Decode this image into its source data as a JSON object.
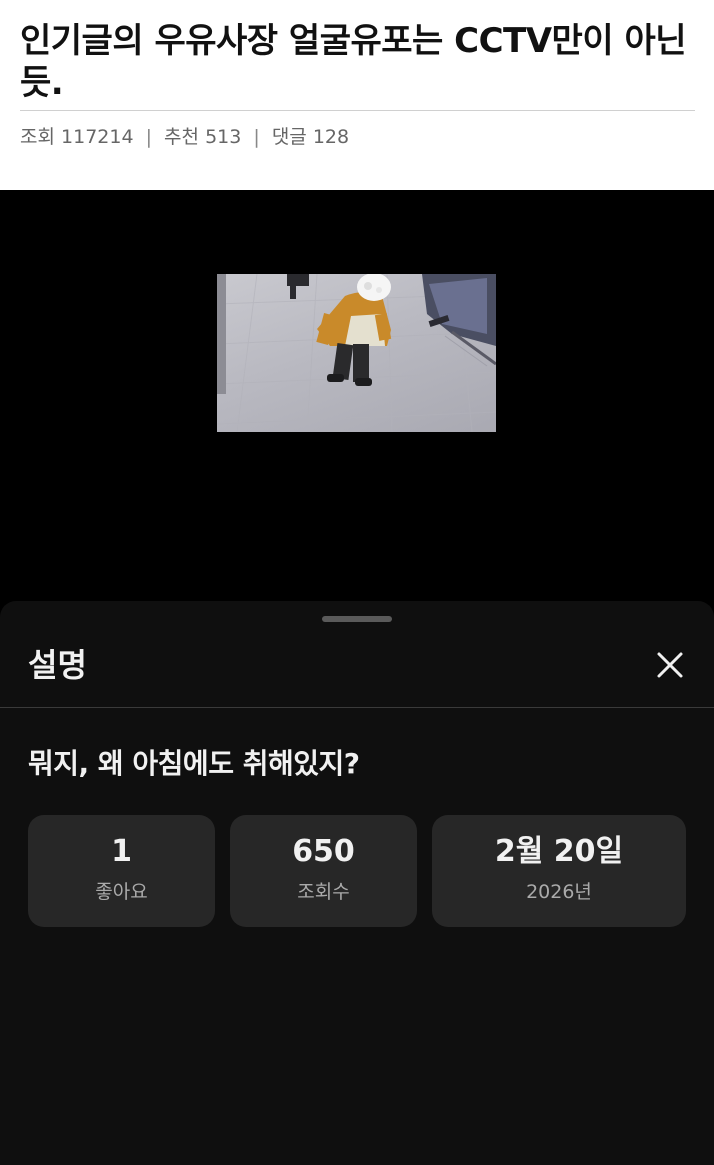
{
  "article": {
    "title": "인기글의 우유사장 얼굴유포는 CCTV만이 아닌 듯.",
    "meta": {
      "views_label": "조회",
      "views": "117214",
      "recommend_label": "추천",
      "recommends": "513",
      "comments_label": "댓글",
      "comments": "128"
    }
  },
  "sheet": {
    "title": "설명",
    "close_icon": "close-icon",
    "description": "뭐지, 왜 아침에도 취해있지?",
    "stats": [
      {
        "value": "1",
        "label": "좋아요"
      },
      {
        "value": "650",
        "label": "조회수"
      },
      {
        "value": "2월 20일",
        "label": "2026년"
      }
    ]
  },
  "colors": {
    "sheet_bg": "#0f0f0f",
    "card_bg": "#272727",
    "text_primary": "#f1f1f1",
    "text_secondary": "#aaaaaa"
  }
}
